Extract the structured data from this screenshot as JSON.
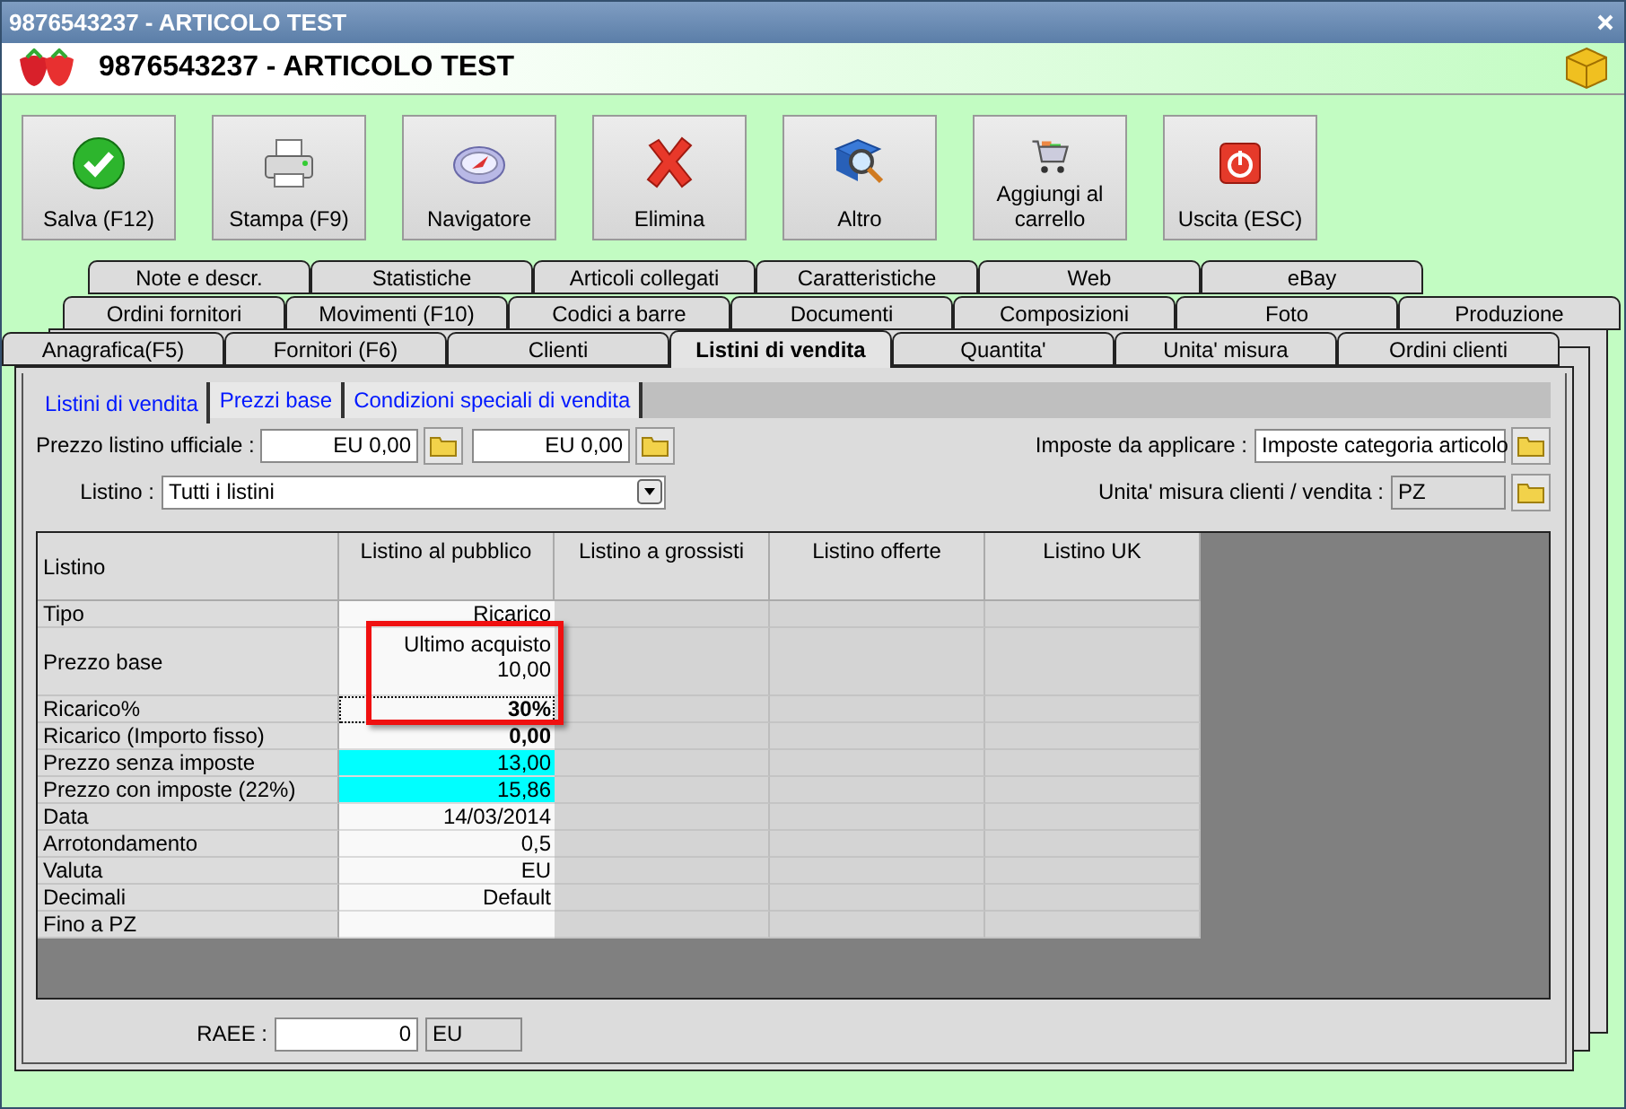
{
  "window": {
    "title": "9876543237 - ARTICOLO TEST"
  },
  "header": {
    "title": "9876543237 - ARTICOLO TEST"
  },
  "toolbar": [
    {
      "label": "Salva (F12)",
      "kind": "check"
    },
    {
      "label": "Stampa (F9)",
      "kind": "printer"
    },
    {
      "label": "Navigatore",
      "kind": "compass"
    },
    {
      "label": "Elimina",
      "kind": "cross"
    },
    {
      "label": "Altro",
      "kind": "search"
    },
    {
      "label": "Aggiungi al carrello",
      "kind": "cart"
    },
    {
      "label": "Uscita (ESC)",
      "kind": "power"
    }
  ],
  "tab_rows": [
    [
      {
        "label": "Note e descr.",
        "selected": false
      },
      {
        "label": "Statistiche",
        "selected": false
      },
      {
        "label": "Articoli collegati",
        "selected": false
      },
      {
        "label": "Caratteristiche",
        "selected": false
      },
      {
        "label": "Web",
        "selected": false
      },
      {
        "label": "eBay",
        "selected": false
      }
    ],
    [
      {
        "label": "Ordini fornitori",
        "selected": false
      },
      {
        "label": "Movimenti (F10)",
        "selected": false
      },
      {
        "label": "Codici a barre",
        "selected": false
      },
      {
        "label": "Documenti",
        "selected": false
      },
      {
        "label": "Composizioni",
        "selected": false
      },
      {
        "label": "Foto",
        "selected": false
      },
      {
        "label": "Produzione",
        "selected": false
      }
    ],
    [
      {
        "label": "Anagrafica(F5)",
        "selected": false
      },
      {
        "label": "Fornitori (F6)",
        "selected": false
      },
      {
        "label": "Clienti",
        "selected": false
      },
      {
        "label": "Listini di vendita",
        "selected": true
      },
      {
        "label": "Quantita'",
        "selected": false
      },
      {
        "label": "Unita' misura",
        "selected": false
      },
      {
        "label": "Ordini clienti",
        "selected": false
      }
    ]
  ],
  "subtabs": [
    {
      "label": "Listini di vendita",
      "selected": true
    },
    {
      "label": "Prezzi base",
      "selected": false
    },
    {
      "label": "Condizioni speciali di vendita",
      "selected": false
    }
  ],
  "fields": {
    "prezzo_listino_ufficiale": {
      "label": "Prezzo listino ufficiale :",
      "values": [
        "EU 0,00",
        "EU 0,00"
      ]
    },
    "listino": {
      "label": "Listino :",
      "value": "Tutti i listini"
    },
    "imposte": {
      "label": "Imposte da applicare :",
      "value": "Imposte categoria articolo"
    },
    "unita_misura": {
      "label": "Unita' misura clienti / vendita :",
      "value": "PZ"
    }
  },
  "table": {
    "columns": [
      "Listino",
      "Listino al pubblico",
      "Listino a grossisti",
      "Listino offerte",
      "Listino UK"
    ],
    "rows": [
      {
        "label": "Tipo",
        "lines": [
          "Ricarico"
        ],
        "bold": false,
        "highlighted": false,
        "focused": false
      },
      {
        "label": "Prezzo base",
        "lines": [
          "Ultimo acquisto",
          "10,00"
        ],
        "bold": false,
        "highlighted": false,
        "focused": false
      },
      {
        "label": "Ricarico%",
        "lines": [
          "30%"
        ],
        "bold": true,
        "highlighted": false,
        "focused": true
      },
      {
        "label": "Ricarico (Importo fisso)",
        "lines": [
          "0,00"
        ],
        "bold": true,
        "highlighted": false,
        "focused": false
      },
      {
        "label": "Prezzo senza imposte",
        "lines": [
          "13,00"
        ],
        "bold": false,
        "highlighted": true,
        "focused": false
      },
      {
        "label": "Prezzo con imposte (22%)",
        "lines": [
          "15,86"
        ],
        "bold": false,
        "highlighted": true,
        "focused": false
      },
      {
        "label": "Data",
        "lines": [
          "14/03/2014"
        ],
        "bold": false,
        "highlighted": false,
        "focused": false
      },
      {
        "label": "Arrotondamento",
        "lines": [
          "0,5"
        ],
        "bold": false,
        "highlighted": false,
        "focused": false
      },
      {
        "label": "Valuta",
        "lines": [
          "EU"
        ],
        "bold": false,
        "highlighted": false,
        "focused": false
      },
      {
        "label": "Decimali",
        "lines": [
          "Default"
        ],
        "bold": false,
        "highlighted": false,
        "focused": false
      },
      {
        "label": "Fino a PZ",
        "lines": [],
        "highlighted": false,
        "focused": false
      }
    ]
  },
  "raee": {
    "label": "RAEE :",
    "value": "0",
    "unit": "EU"
  }
}
